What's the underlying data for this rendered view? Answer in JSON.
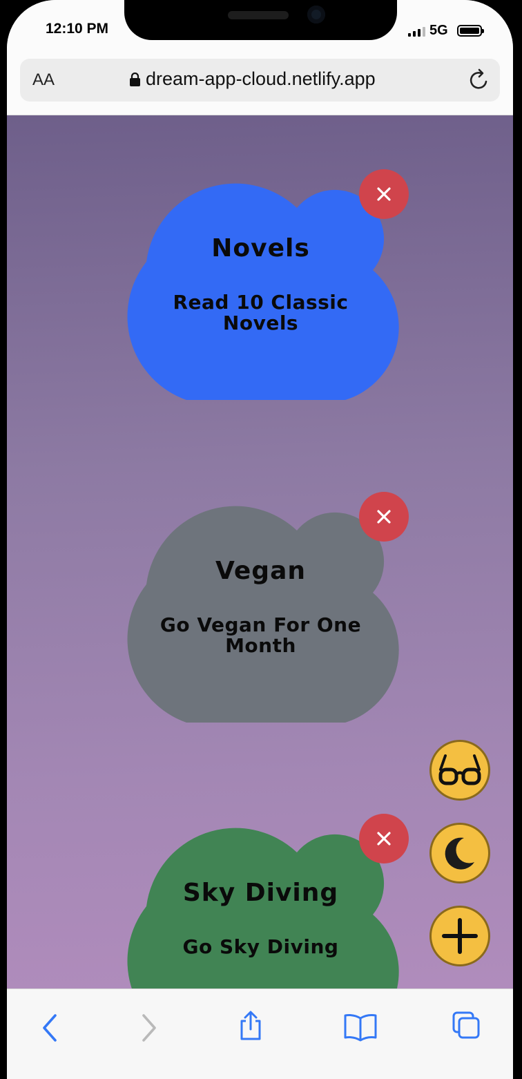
{
  "status_bar": {
    "time": "12:10 PM",
    "network": "5G",
    "icons": [
      "signal-icon",
      "battery-icon"
    ]
  },
  "browser": {
    "text_size_label": "AA",
    "url": "dream-app-cloud.netlify.app",
    "icons": [
      "lock-icon",
      "reload-icon"
    ]
  },
  "dreams": [
    {
      "title": "Novels",
      "description": "Read 10 Classic Novels",
      "color": "#336af5"
    },
    {
      "title": "Vegan",
      "description": "Go Vegan For One Month",
      "color": "#6e747c"
    },
    {
      "title": "Sky Diving",
      "description": "Go Sky Diving",
      "color": "#418454"
    }
  ],
  "colors": {
    "delete_button": "#d0444c",
    "fab": "#f4bf41",
    "toolbar_icon": "#3478f6"
  },
  "fabs": [
    "glasses-icon",
    "moon-icon",
    "plus-icon"
  ],
  "toolbar": [
    "back-icon",
    "forward-icon",
    "share-icon",
    "bookmarks-icon",
    "tabs-icon"
  ]
}
